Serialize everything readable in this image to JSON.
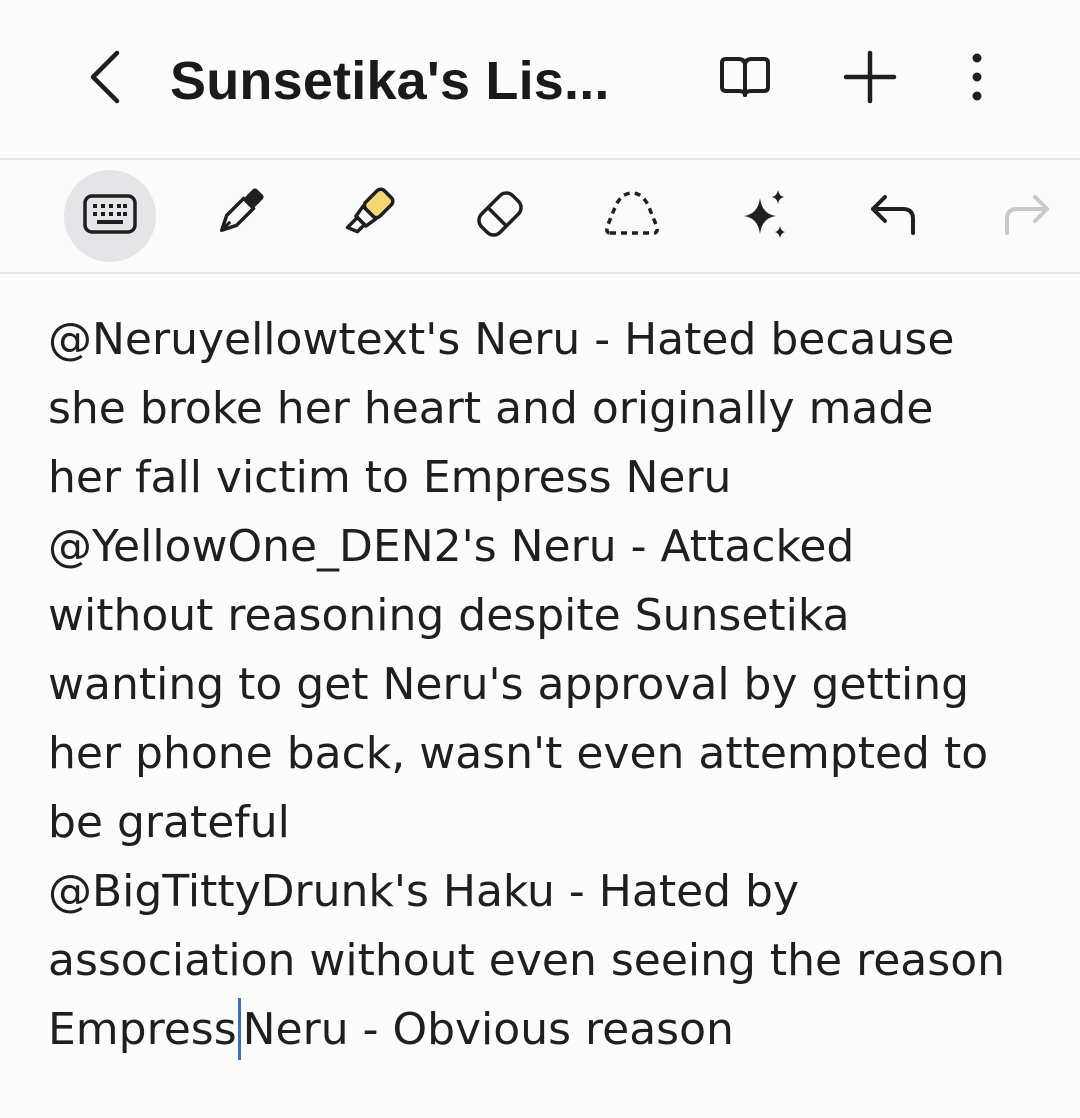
{
  "header": {
    "title": "Sunsetika's Lis..."
  },
  "icons": {
    "back": "chevron-left-icon",
    "reading_mode": "book-icon",
    "add": "plus-icon",
    "more": "more-vertical-icon"
  },
  "toolbar": {
    "tools": [
      "keyboard",
      "pen",
      "highlighter",
      "eraser",
      "lasso-select",
      "ai-assist",
      "undo",
      "redo"
    ],
    "active_tool": "keyboard",
    "redo_enabled": false
  },
  "note": {
    "lines": [
      "@Neruyellowtext's Neru - Hated because",
      "she broke her heart and originally made",
      "her fall victim to Empress Neru",
      "@YellowOne_DEN2's Neru - Attacked",
      "without reasoning despite Sunsetika",
      "wanting to get Neru's approval by getting",
      "her phone back, wasn't even attempted to",
      "be grateful",
      "@BigTittyDrunk's Haku - Hated by",
      "association without even seeing the reason"
    ],
    "last_line_before_cursor": "Empress",
    "last_line_after_cursor": "Neru - Obvious reason"
  },
  "colors": {
    "background": "#fcfcfd",
    "cursor": "#3a6fc9",
    "highlighter": "#f7d774",
    "active_tool_bg": "#e5e5e7"
  }
}
